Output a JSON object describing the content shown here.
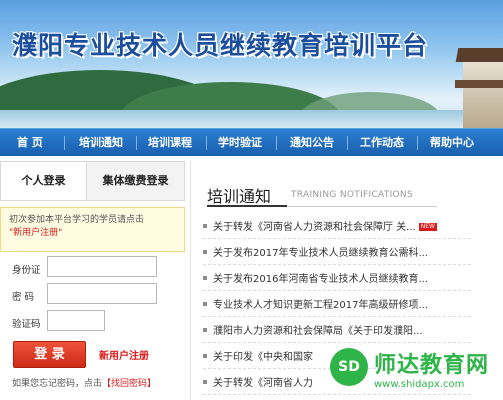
{
  "banner": {
    "title": "濮阳专业技术人员继续教育培训平台"
  },
  "nav": {
    "items": [
      {
        "label": "首  页"
      },
      {
        "label": "培训通知"
      },
      {
        "label": "培训课程"
      },
      {
        "label": "学时验证"
      },
      {
        "label": "通知公告"
      },
      {
        "label": "工作动态"
      },
      {
        "label": "帮助中心"
      }
    ]
  },
  "login": {
    "tabs": [
      {
        "label": "个人登录"
      },
      {
        "label": "集体缴费登录"
      }
    ],
    "notice_text": "初次参加本平台学习的学员请点击",
    "notice_link": "\"新用户注册\"",
    "id_label": "身份证",
    "password_label": "密  码",
    "captcha_label": "验证码",
    "id_value": "",
    "password_value": "",
    "captcha_value": "",
    "login_button": "登 录",
    "register_link": "新用户注册",
    "forgot_text": "如果您忘记密码，点击",
    "forgot_link": "【找回密码】"
  },
  "news": {
    "title": "培训通知",
    "subtitle": "TRAINING NOTIFICATIONS",
    "new_badge": "NEW",
    "items": [
      {
        "title": "关于转发《河南省人力资源和社会保障厅 关..."
      },
      {
        "title": "关于发布2017年专业技术人员继续教育公需科..."
      },
      {
        "title": "关于发布2016年河南省专业技术人员继续教育..."
      },
      {
        "title": "专业技术人才知识更新工程2017年高级研修项..."
      },
      {
        "title": "濮阳市人力资源和社会保障局《关于印发濮阳..."
      },
      {
        "title": "关于印发《中央和国家"
      },
      {
        "title": "关于转发《河南省人力"
      }
    ]
  },
  "watermark": {
    "logo": "SD",
    "name": "师达教育网",
    "url": "www.shidapx.com"
  },
  "colors": {
    "nav_bg": "#1a5fae",
    "accent_red": "#d91a1a",
    "title_blue": "#1b4e9c",
    "watermark_green": "#2fb44a"
  }
}
